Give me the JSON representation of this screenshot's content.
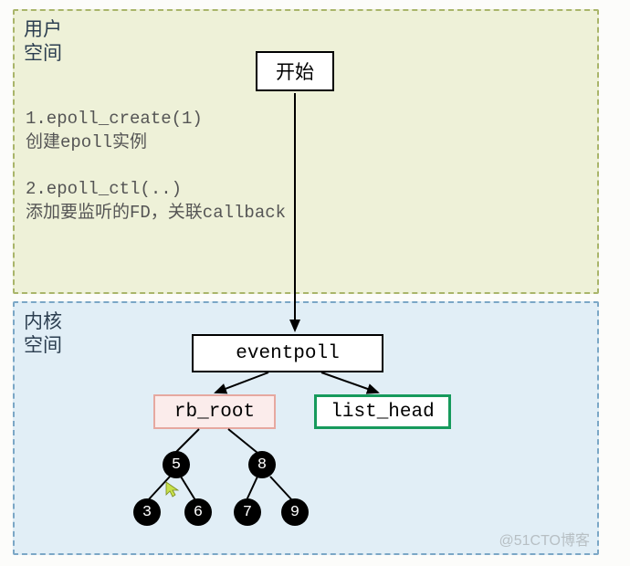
{
  "zones": {
    "user": {
      "title_l1": "用户",
      "title_l2": "空间"
    },
    "kernel": {
      "title_l1": "内核",
      "title_l2": "空间"
    }
  },
  "start": {
    "label": "开始"
  },
  "steps": {
    "s1a": "1.epoll_create(1)",
    "s1b": "创建epoll实例",
    "s2a": "2.epoll_ctl(..)",
    "s2b": "添加要监听的FD，关联callback"
  },
  "boxes": {
    "eventpoll": "eventpoll",
    "rb_root": "rb_root",
    "list_head": "list_head"
  },
  "tree": {
    "n5": "5",
    "n8": "8",
    "n3": "3",
    "n6": "6",
    "n7": "7",
    "n9": "9"
  },
  "watermark": "@51CTO博客"
}
